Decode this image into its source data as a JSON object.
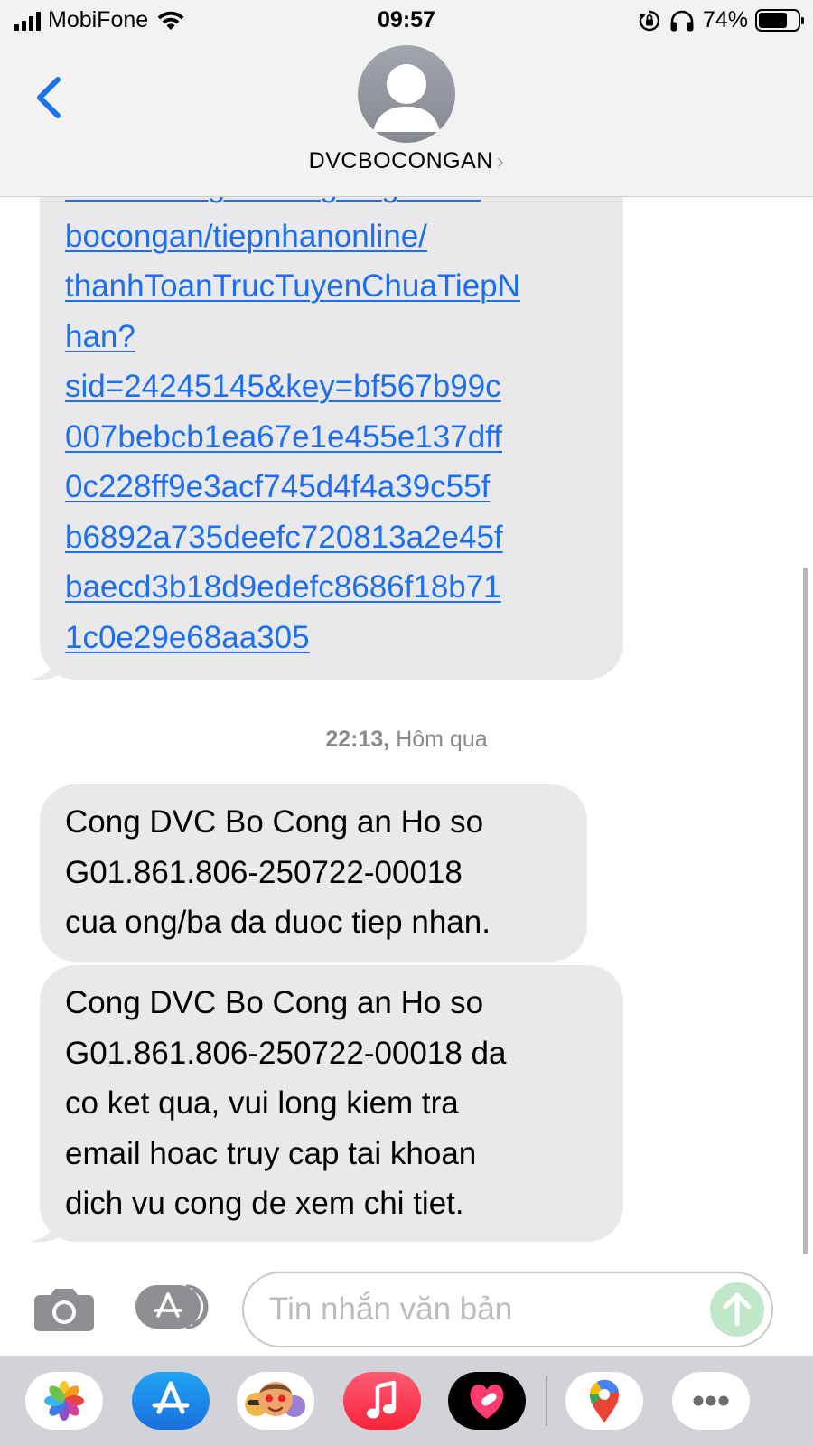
{
  "status_bar": {
    "carrier": "MobiFone",
    "time": "09:57",
    "battery_percent": "74%",
    "battery_level": 0.74
  },
  "header": {
    "contact_name": "DVCBOCONGAN",
    "back_icon": "chevron-left-icon",
    "avatar_icon": "person-silhouette-icon",
    "accent_color": "#1a73e8"
  },
  "messages": {
    "first": {
      "lines": [
        "dichvucong.bocongan.gov.vn/",
        "bocongan/tiepnhanonline/",
        "thanhToanTrucTuyenChuaTiepN",
        "han?",
        "sid=24245145&key=bf567b99c",
        "007bebcb1ea67e1e455e137dff",
        "0c228ff9e3acf745d4f4a39c55f",
        "b6892a735deefc720813a2e45f",
        "baecd3b18d9edefc8686f18b71",
        "1c0e29e68aa305"
      ]
    },
    "timestamp": {
      "time": "22:13,",
      "day": "Hôm qua"
    },
    "second": {
      "lines": [
        "Cong DVC Bo Cong an Ho so",
        "G01.861.806-250722-00018",
        "cua ong/ba da duoc tiep nhan."
      ]
    },
    "third": {
      "lines": [
        "Cong DVC Bo Cong an Ho so",
        "G01.861.806-250722-00018 da",
        "co ket qua, vui long kiem tra",
        "email hoac truy cap tai khoan",
        "dich vu cong de xem chi tiet."
      ]
    },
    "bubble_color": "#e9e9eb",
    "link_color": "#1c6ef2"
  },
  "input_bar": {
    "placeholder": "Tin nhắn văn bản",
    "camera_icon": "camera-icon",
    "apps_icon": "app-store-toggle-icon",
    "send_icon": "arrow-up-send-icon"
  },
  "app_drawer": {
    "apps": [
      "photos-icon",
      "app-store-icon",
      "memoji-stickers-icon",
      "music-icon",
      "fitness-heart-icon",
      "maps-icon",
      "more-icon"
    ]
  }
}
